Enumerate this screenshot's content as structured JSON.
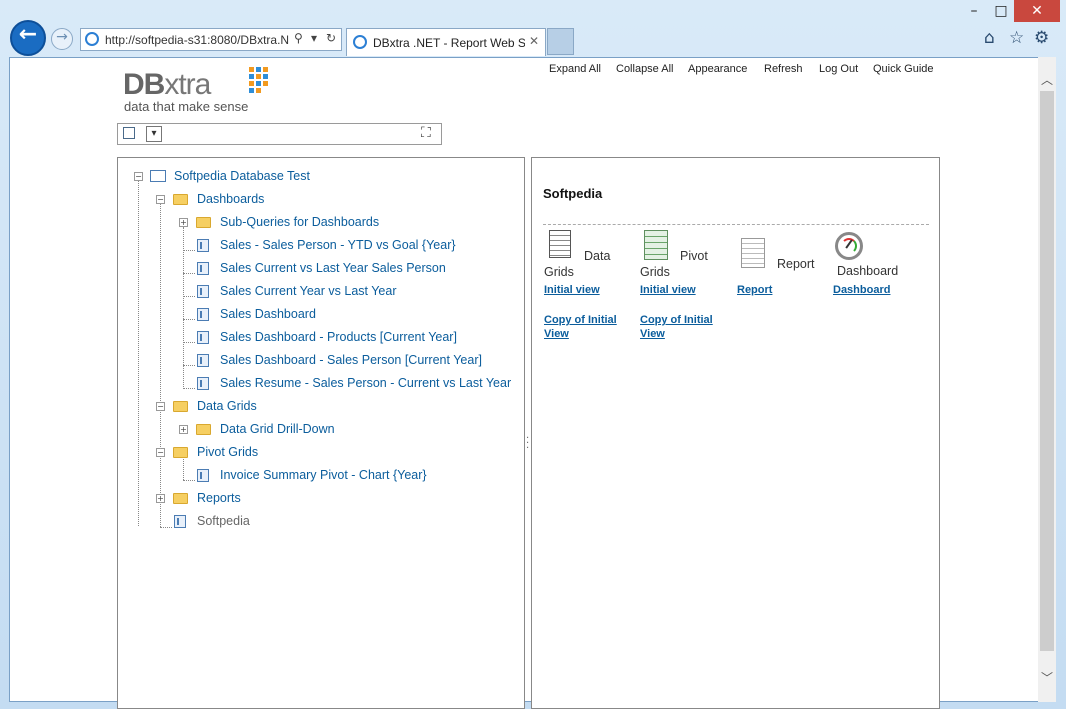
{
  "browser": {
    "window_controls": {
      "minimize": "–",
      "maximize": "□",
      "close": "✕"
    },
    "back_glyph": "←",
    "forward_glyph": "→",
    "url": "http://softpedia-s31:8080/DBxtra.N",
    "tab_title": "DBxtra .NET - Report Web S...",
    "tab_close": "✕"
  },
  "app": {
    "logo_primary": "DB",
    "logo_secondary": "xtra",
    "tagline": "data that make sense",
    "brand_dot_colors": [
      "#f29a1f",
      "#2d8ed9"
    ]
  },
  "menu": {
    "expand_all": "Expand All",
    "collapse_all": "Collapse All",
    "appearance": "Appearance",
    "refresh": "Refresh",
    "log_out": "Log Out",
    "quick_guide": "Quick Guide"
  },
  "tree": {
    "root": "Softpedia Database Test",
    "dashboards": "Dashboards",
    "subqueries": "Sub-Queries for Dashboards",
    "dash_items": [
      "Sales - Sales Person - YTD vs Goal {Year}",
      "Sales Current vs Last Year Sales Person",
      "Sales Current Year vs Last Year",
      "Sales Dashboard",
      "Sales Dashboard - Products [Current Year]",
      "Sales Dashboard - Sales Person [Current Year]",
      "Sales Resume - Sales Person - Current vs Last Year"
    ],
    "data_grids": "Data Grids",
    "drill_down": "Data Grid Drill-Down",
    "pivot_grids": "Pivot Grids",
    "invoice_pivot": "Invoice Summary Pivot - Chart {Year}",
    "reports": "Reports",
    "softpedia": "Softpedia"
  },
  "panel": {
    "title": "Softpedia",
    "data_grids": {
      "label_a": "Data",
      "label_b": "Grids",
      "link1": "Initial view",
      "link2a": "Copy of Initial",
      "link2b": "View"
    },
    "pivot_grids": {
      "label_a": "Pivot",
      "label_b": "Grids",
      "link1": "Initial view",
      "link2a": "Copy of Initial",
      "link2b": "View"
    },
    "report": {
      "label": "Report",
      "link1": "Report"
    },
    "dashboard": {
      "label": "Dashboard",
      "link1": "Dashboard"
    }
  }
}
